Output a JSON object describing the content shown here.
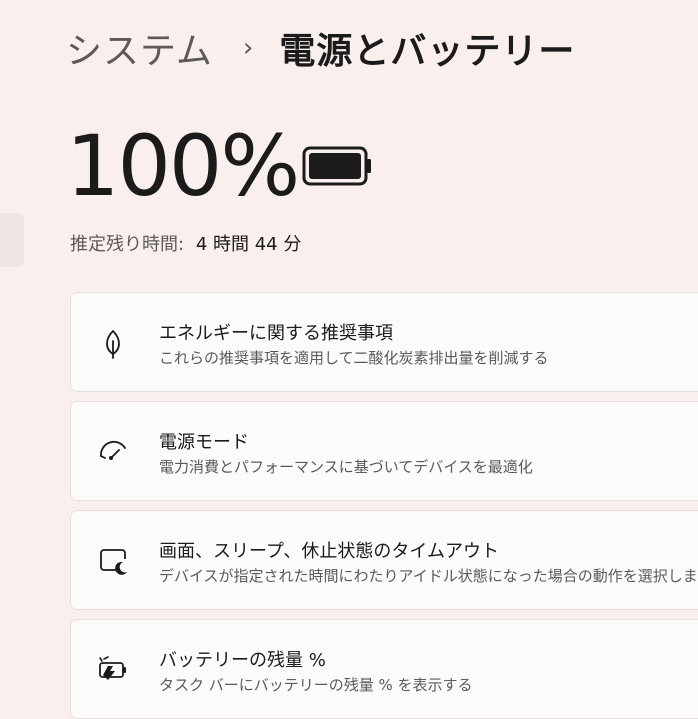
{
  "breadcrumb": {
    "parent": "システム",
    "separator": "›",
    "current": "電源とバッテリー"
  },
  "battery": {
    "percent": "100%",
    "level": 1.0,
    "estimate_label": "推定残り時間:",
    "estimate_value": "4 時間 44 分"
  },
  "cards": [
    {
      "icon": "leaf-icon",
      "title": "エネルギーに関する推奨事項",
      "subtitle": "これらの推奨事項を適用して二酸化炭素排出量を削減する"
    },
    {
      "icon": "gauge-icon",
      "title": "電源モード",
      "subtitle": "電力消費とパフォーマンスに基づいてデバイスを最適化"
    },
    {
      "icon": "screen-sleep-icon",
      "title": "画面、スリープ、休止状態のタイムアウト",
      "subtitle": "デバイスが指定された時間にわたりアイドル状態になった場合の動作を選択します"
    },
    {
      "icon": "battery-saver-icon",
      "title": "バッテリーの残量 %",
      "subtitle": "タスク バーにバッテリーの残量 % を表示する"
    }
  ],
  "colors": {
    "background": "#f9f0ee",
    "card": "#fdfbfa",
    "text_primary": "#1b1b1b",
    "text_secondary": "#5c5a59"
  }
}
